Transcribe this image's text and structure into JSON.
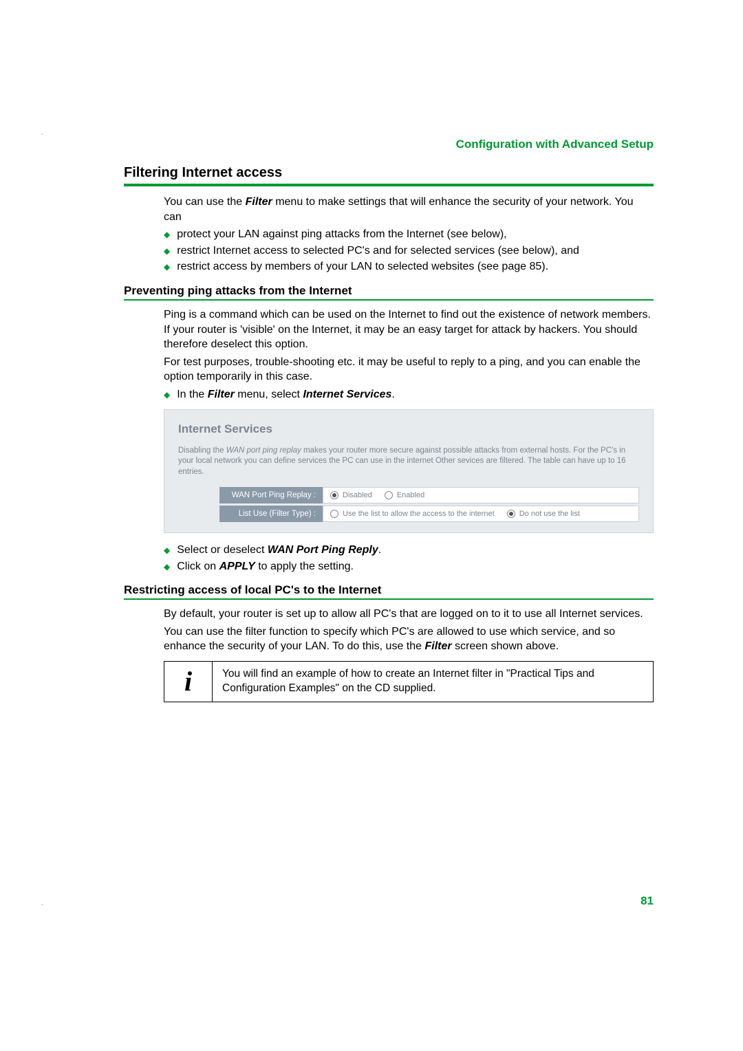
{
  "crop_mark": "-",
  "header": "Configuration with Advanced Setup",
  "h2": "Filtering Internet access",
  "intro_a": "You can use the ",
  "intro_filter": "Filter",
  "intro_b": " menu to make settings that will enhance the security of your network. You can",
  "bullets1": [
    "protect your LAN against ping attacks from the Internet (see below),",
    "restrict Internet access to selected PC's and for selected services (see below), and",
    "restrict access by members of your LAN to selected websites (see page 85)."
  ],
  "h3a": "Preventing ping attacks from the Internet",
  "ping_p1": "Ping is a command which can be used on the Internet to find out the existence of network members. If your router is 'visible' on the Internet, it may be an easy target for attack by hackers. You should therefore deselect this option.",
  "ping_p2": "For test purposes, trouble-shooting etc. it may be useful to reply to a ping, and you can enable the option temporarily in this case.",
  "ping_step_a": "In the ",
  "ping_step_filter": "Filter",
  "ping_step_b": " menu, select ",
  "ping_step_is": "Internet Services",
  "ping_step_c": ".",
  "screenshot": {
    "title": "Internet Services",
    "desc_a": "Disabling the ",
    "desc_i": "WAN port ping replay",
    "desc_b": " makes your router more secure against possible attacks from external hosts. For the PC's in your local network you can define services the PC can use in the internet Other sevices are filtered. The table can have up to 16 entries.",
    "row1_label": "WAN Port Ping Replay :",
    "row1_opt1": "Disabled",
    "row1_opt2": "Enabled",
    "row2_label": "List Use (Filter Type) :",
    "row2_opt1": "Use the list to allow the access to the internet",
    "row2_opt2": "Do not use the list"
  },
  "after_bullets_a": "Select or deselect ",
  "after_bullets_bold": "WAN Port Ping Reply",
  "after_bullets_c": ".",
  "after_bullets2_a": "Click on ",
  "after_bullets2_bold": "APPLY",
  "after_bullets2_c": " to apply the setting.",
  "h3b": "Restricting access of local PC's to the Internet",
  "rest_p1": "By default, your router is set up to allow all PC's that are logged on to it to use all Internet services.",
  "rest_p2_a": "You can use the filter function to specify which PC's are allowed to use which service, and so enhance the security of your LAN. To do this, use the ",
  "rest_p2_bold": "Filter",
  "rest_p2_c": " screen shown above.",
  "info_icon": "i",
  "info_text": "You will find an example of how to create an Internet filter in \"Practical Tips and Configuration Examples\" on the CD supplied.",
  "page_number": "81"
}
